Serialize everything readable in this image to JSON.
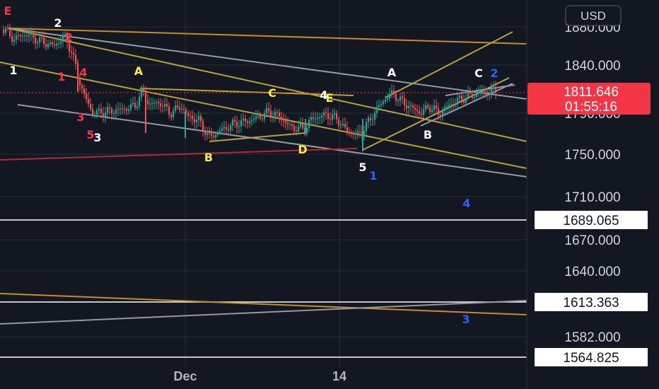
{
  "chart_data": {
    "type": "candlestick",
    "currency": "USD",
    "ylim": [
      1550,
      1895
    ],
    "y_ticks": [
      "1880.000",
      "1840.000",
      "1790.000",
      "1750.000",
      "1710.000",
      "1670.000",
      "1640.000",
      "1582.000"
    ],
    "x_ticks": [
      "Dec",
      "14"
    ],
    "current_price": "1811.646",
    "countdown": "01:55:16",
    "levels": [
      "1689.065",
      "1613.363",
      "1564.825"
    ],
    "wave_labels": [
      {
        "text": "E",
        "color": "#f23645"
      },
      {
        "text": "2",
        "color": "#ffffff"
      },
      {
        "text": "2",
        "color": "#f23645"
      },
      {
        "text": "1",
        "color": "#ffffff"
      },
      {
        "text": "1",
        "color": "#f23645"
      },
      {
        "text": "4",
        "color": "#f23645"
      },
      {
        "text": "3",
        "color": "#f23645"
      },
      {
        "text": "5",
        "color": "#f23645"
      },
      {
        "text": "3",
        "color": "#ffffff"
      },
      {
        "text": "A",
        "color": "#ffeb3b"
      },
      {
        "text": "B",
        "color": "#ffeb3b"
      },
      {
        "text": "C",
        "color": "#ffeb3b"
      },
      {
        "text": "D",
        "color": "#ffeb3b"
      },
      {
        "text": "E",
        "color": "#ffeb3b"
      },
      {
        "text": "4",
        "color": "#ffffff"
      },
      {
        "text": "5",
        "color": "#ffffff"
      },
      {
        "text": "1",
        "color": "#2962ff"
      },
      {
        "text": "A",
        "color": "#ffffff"
      },
      {
        "text": "B",
        "color": "#ffffff"
      },
      {
        "text": "C",
        "color": "#ffffff"
      },
      {
        "text": "2",
        "color": "#2962ff"
      },
      {
        "text": "4",
        "color": "#2962ff"
      },
      {
        "text": "3",
        "color": "#2962ff"
      }
    ],
    "colors": {
      "background": "#131722",
      "up": "#26a69a",
      "down": "#ef5350",
      "grid": "#2a2e39",
      "price_tag": "#f23645",
      "channel_gold": "#b5a33a",
      "channel_orange": "#c98a2c",
      "channel_grey": "#9598a1",
      "support_red": "#b22833"
    }
  }
}
